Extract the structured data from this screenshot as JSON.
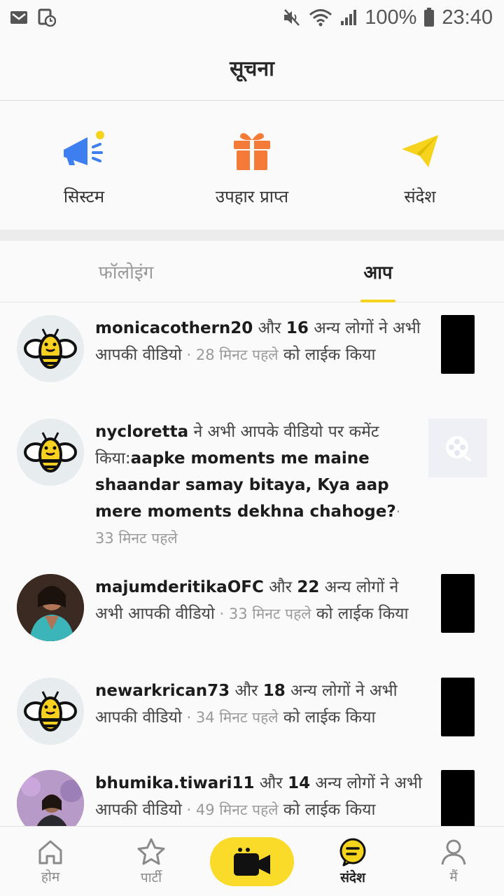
{
  "status_bar": {
    "battery": "100%",
    "time": "23:40"
  },
  "header": {
    "title": "सूचना"
  },
  "categories": [
    {
      "label": "सिस्टम",
      "icon": "megaphone-icon",
      "color": "#3d7ef0"
    },
    {
      "label": "उपहार प्राप्त",
      "icon": "gift-icon",
      "color": "#f57a37"
    },
    {
      "label": "संदेश",
      "icon": "paper-plane-icon",
      "color": "#f6d31d"
    }
  ],
  "tabs": [
    {
      "label": "फॉलोइंग",
      "active": false
    },
    {
      "label": "आप",
      "active": true
    }
  ],
  "notifications": [
    {
      "username": "monicacothern20",
      "pre": " और ",
      "count": "16",
      "mid": " अन्य लोगों ने अभी आपकी वीडियो",
      "time": " · 28 मिनट पहले",
      "post": " को लाईक किया",
      "avatar": "bee"
    },
    {
      "username": "nycloretta",
      "pre": " ने अभी आपके वीडियो पर कमेंट किया:",
      "comment": "aapke moments me maine shaandar samay bitaya, Kya aap mere moments dekhna chahoge?",
      "time": "· 33 मिनट पहले",
      "avatar": "bee"
    },
    {
      "username": "majumderitikaOFC",
      "pre": " और ",
      "count": "22",
      "mid": " अन्य लोगों ने अभी आपकी वीडियो",
      "time": " · 33 मिनट पहले",
      "post": " को लाईक किया",
      "avatar": "photo"
    },
    {
      "username": "newarkrican73",
      "pre": " और ",
      "count": "18",
      "mid": " अन्य लोगों ने अभी आपकी वीडियो",
      "time": " · 34 मिनट पहले",
      "post": " को लाईक किया",
      "avatar": "bee"
    },
    {
      "username": "bhumika.tiwari11",
      "pre": " और ",
      "count": "14",
      "mid": " अन्य लोगों ने अभी आपकी वीडियो",
      "time": " · 49 मिनट पहले",
      "post": " को लाईक किया",
      "avatar": "photo2"
    }
  ],
  "bottom_nav": [
    {
      "label": "होम",
      "icon": "home-icon"
    },
    {
      "label": "पार्टी",
      "icon": "star-icon"
    },
    {
      "label": "",
      "icon": "video-camera-icon"
    },
    {
      "label": "संदेश",
      "icon": "message-icon",
      "active": true
    },
    {
      "label": "मैं",
      "icon": "profile-icon"
    }
  ],
  "colors": {
    "accent": "#f6d31d",
    "nav_center": "#fadb29"
  }
}
